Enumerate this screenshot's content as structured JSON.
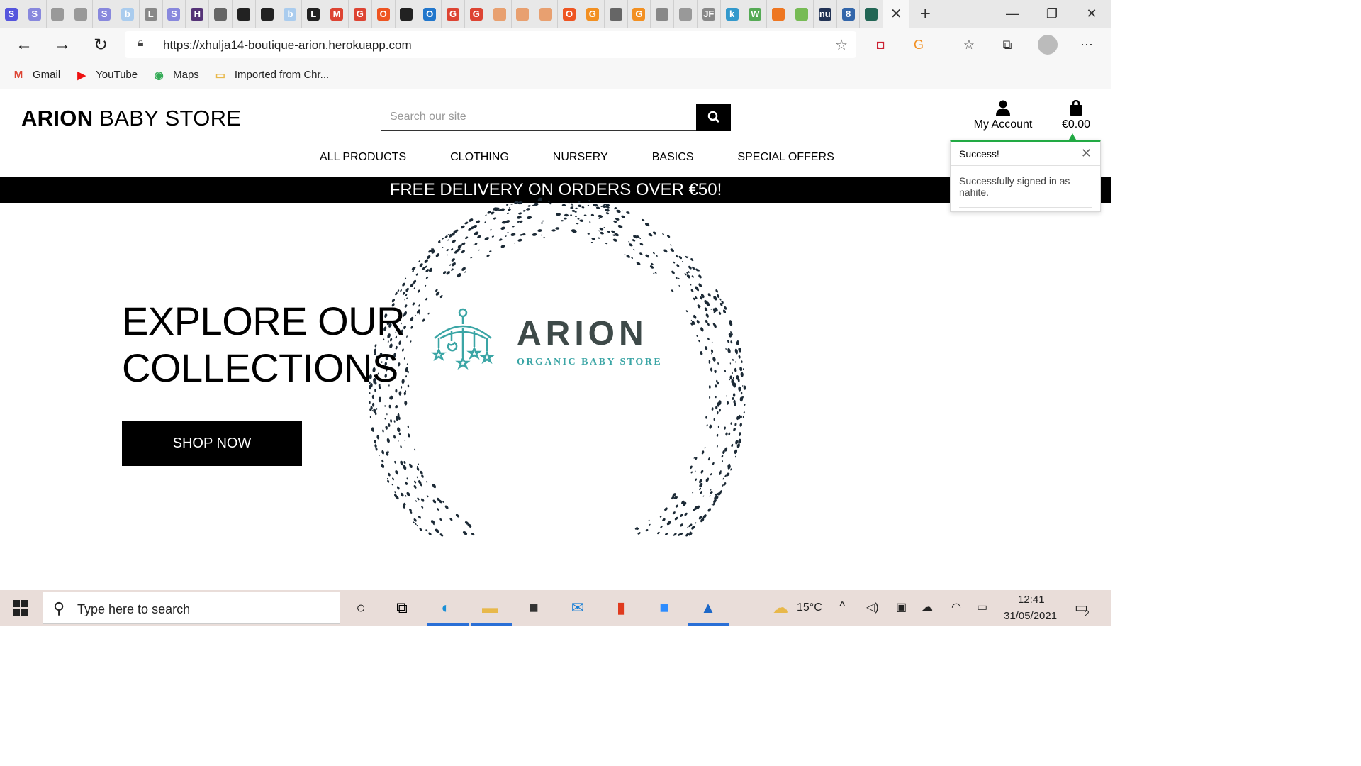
{
  "browser": {
    "favicons": [
      {
        "letter": "S",
        "bg": "#5555dd"
      },
      {
        "letter": "S",
        "bg": "#8888dd"
      },
      {
        "letter": "",
        "bg": "#999"
      },
      {
        "letter": "",
        "bg": "#999"
      },
      {
        "letter": "S",
        "bg": "#8888dd"
      },
      {
        "letter": "b",
        "bg": "#aaccee"
      },
      {
        "letter": "L",
        "bg": "#888"
      },
      {
        "letter": "S",
        "bg": "#8888dd"
      },
      {
        "letter": "H",
        "bg": "#553377"
      },
      {
        "letter": "",
        "bg": "#666"
      },
      {
        "letter": "",
        "bg": "#222"
      },
      {
        "letter": "",
        "bg": "#222"
      },
      {
        "letter": "b",
        "bg": "#aaccee"
      },
      {
        "letter": "L",
        "bg": "#222"
      },
      {
        "letter": "M",
        "bg": "#dd4433"
      },
      {
        "letter": "G",
        "bg": "#dd4433"
      },
      {
        "letter": "O",
        "bg": "#ee5522"
      },
      {
        "letter": "",
        "bg": "#222"
      },
      {
        "letter": "O",
        "bg": "#2277cc"
      },
      {
        "letter": "G",
        "bg": "#dd4433"
      },
      {
        "letter": "G",
        "bg": "#dd4433"
      },
      {
        "letter": "",
        "bg": "#e8a070"
      },
      {
        "letter": "",
        "bg": "#e8a070"
      },
      {
        "letter": "",
        "bg": "#e8a070"
      },
      {
        "letter": "O",
        "bg": "#ee5522"
      },
      {
        "letter": "G",
        "bg": "#f29022"
      },
      {
        "letter": "",
        "bg": "#666"
      },
      {
        "letter": "G",
        "bg": "#f29022"
      },
      {
        "letter": "",
        "bg": "#888"
      },
      {
        "letter": "",
        "bg": "#999"
      },
      {
        "letter": "JF",
        "bg": "#888"
      },
      {
        "letter": "k",
        "bg": "#3399cc"
      },
      {
        "letter": "W",
        "bg": "#55aa55"
      },
      {
        "letter": "",
        "bg": "#ee7722"
      },
      {
        "letter": "",
        "bg": "#77bb55"
      },
      {
        "letter": "nu",
        "bg": "#223355"
      },
      {
        "letter": "8",
        "bg": "#3366aa"
      },
      {
        "letter": "",
        "bg": "#226655"
      }
    ],
    "active_tab_close": "✕",
    "new_tab": "+",
    "url": "https://xhulja14-boutique-arion.herokuapp.com",
    "bookmarks": [
      {
        "label": "Gmail",
        "icon": "gmail-icon",
        "glyph": "M",
        "color": "#dd4433"
      },
      {
        "label": "YouTube",
        "icon": "youtube-icon",
        "glyph": "▶",
        "color": "#ee1111"
      },
      {
        "label": "Maps",
        "icon": "maps-icon",
        "glyph": "◉",
        "color": "#33aa55"
      },
      {
        "label": "Imported from Chr...",
        "icon": "folder-icon",
        "glyph": "▭",
        "color": "#e8b84a"
      }
    ]
  },
  "site": {
    "logo_bold": "ARION",
    "logo_rest": " BABY STORE",
    "search_placeholder": "Search our site",
    "account_label": "My Account",
    "cart_total": "€0.00",
    "nav": [
      "ALL PRODUCTS",
      "CLOTHING",
      "NURSERY",
      "BASICS",
      "SPECIAL OFFERS"
    ],
    "banner": "FREE DELIVERY ON ORDERS OVER €50!",
    "hero_line1": "EXPLORE OUR",
    "hero_line2": "COLLECTIONS",
    "shop_button": "SHOP NOW",
    "brand_name": "ARION",
    "brand_sub": "ORGANIC BABY STORE",
    "colors": {
      "brand_dark": "#3e4a49",
      "brand_teal": "#3aa5a5",
      "toast_green": "#22aa44"
    }
  },
  "toast": {
    "title": "Success!",
    "close": "✕",
    "message": "Successfully signed in as nahite."
  },
  "taskbar": {
    "search_placeholder": "Type here to search",
    "weather": "15°C",
    "time": "12:41",
    "date": "31/05/2021",
    "notifications": "2",
    "apps": [
      "cortana-icon",
      "task-view-icon",
      "edge-icon",
      "file-explorer-icon",
      "store-icon",
      "mail-icon",
      "office-icon",
      "zoom-icon",
      "photos-icon"
    ]
  }
}
